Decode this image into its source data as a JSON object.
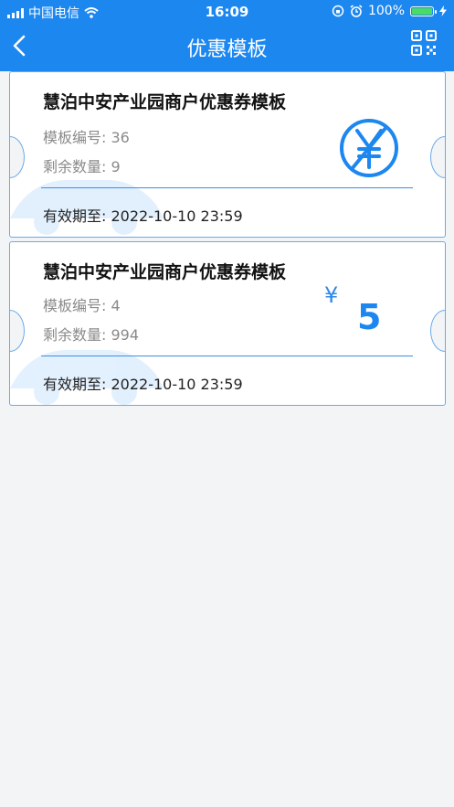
{
  "status_bar": {
    "carrier": "中国电信",
    "time": "16:09",
    "battery": "100%"
  },
  "nav": {
    "title": "优惠模板"
  },
  "coupons": [
    {
      "title": "慧泊中安产业园商户优惠券模板",
      "template_no": "模板编号: 36",
      "remaining": "剩余数量: 9",
      "expiry": "有效期至: 2022-10-10 23:59"
    },
    {
      "title": "慧泊中安产业园商户优惠券模板",
      "template_no": "模板编号: 4",
      "remaining": "剩余数量: 994",
      "expiry": "有效期至: 2022-10-10 23:59",
      "currency": "¥",
      "amount": "5"
    }
  ],
  "icons": [
    "signal-icon",
    "wifi-icon",
    "lock-rotation-icon",
    "alarm-icon",
    "battery-icon",
    "back-icon",
    "qr-code-icon",
    "no-yen-icon",
    "car-watermark-icon"
  ],
  "colors": {
    "primary": "#1d87f0",
    "card_border": "#6aa9ea",
    "background": "#f2f4f5"
  }
}
